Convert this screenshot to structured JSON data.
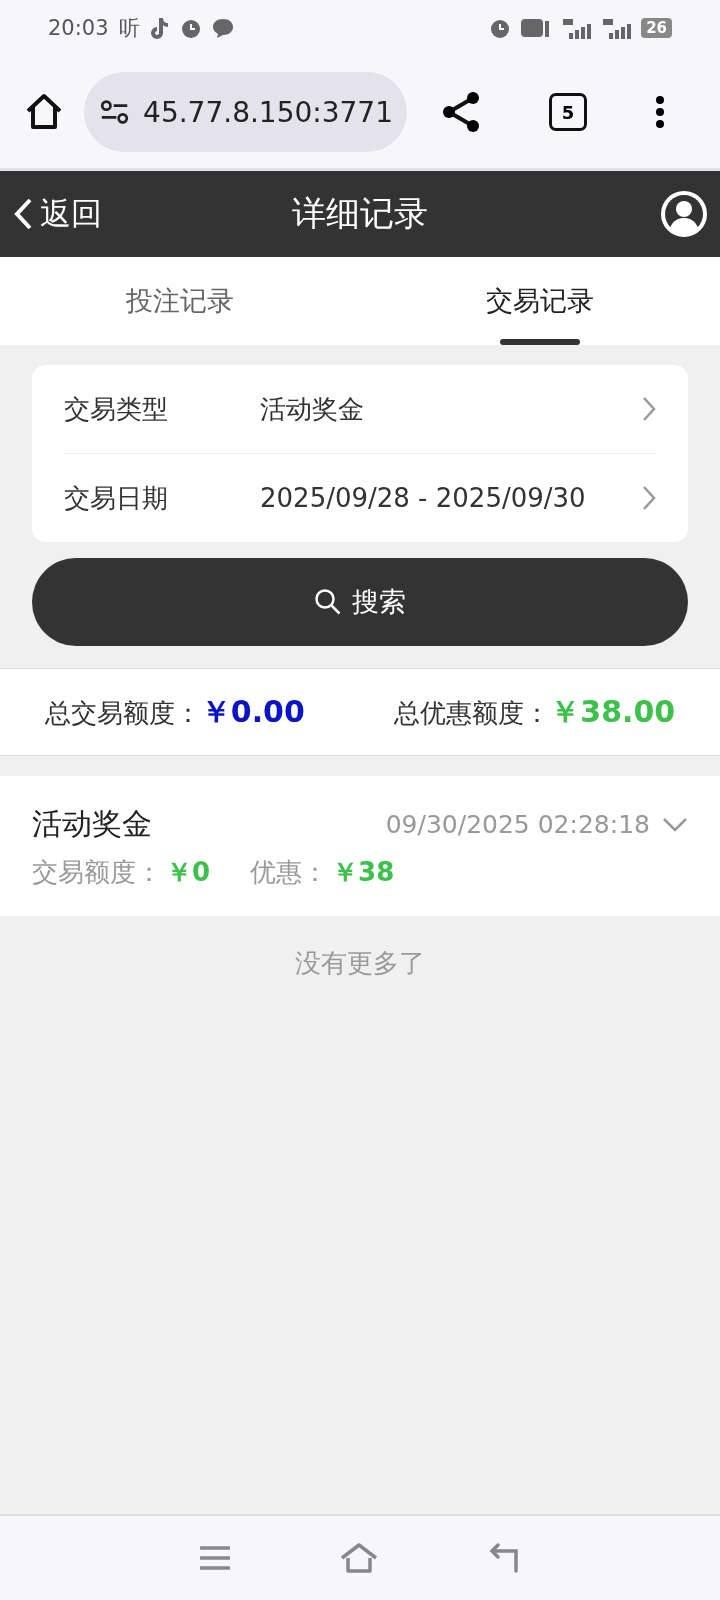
{
  "status_bar": {
    "time": "20:03",
    "listen_glyph": "听",
    "battery": "26"
  },
  "browser": {
    "url": "45.77.8.150:3771",
    "tab_count": "5"
  },
  "header": {
    "back": "返回",
    "title": "详细记录"
  },
  "tabs": [
    {
      "label": "投注记录",
      "selected": false
    },
    {
      "label": "交易记录",
      "selected": true
    }
  ],
  "filters": [
    {
      "label": "交易类型",
      "value": "活动奖金"
    },
    {
      "label": "交易日期",
      "value": "2025/09/28 - 2025/09/30"
    }
  ],
  "search_button": "搜索",
  "summary": [
    {
      "label": "总交易额度：",
      "value": "￥0.00",
      "color": "#0a14c8"
    },
    {
      "label": "总优惠额度：",
      "value": "￥38.00",
      "color": "#3cc24a"
    }
  ],
  "records": [
    {
      "type": "活动奖金",
      "time": "09/30/2025 02:28:18",
      "amount_label": "交易额度：",
      "amount": "￥0",
      "bonus_label": "优惠：",
      "bonus": "￥38",
      "expanded": false
    }
  ],
  "end_note": "没有更多了"
}
